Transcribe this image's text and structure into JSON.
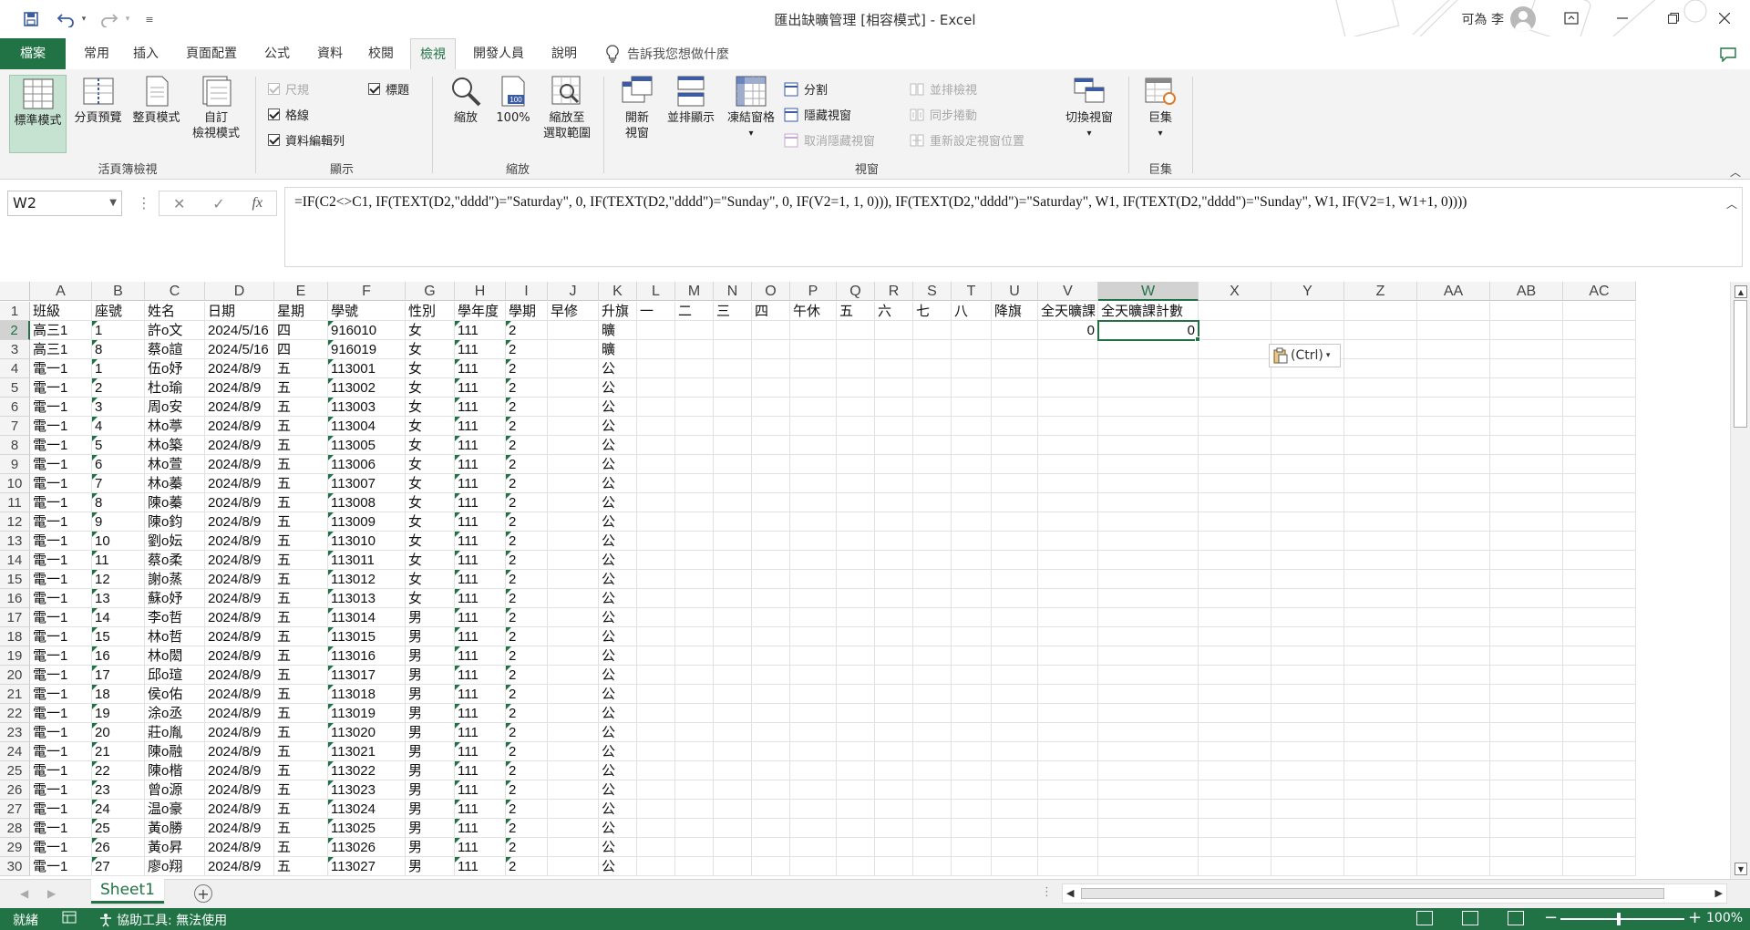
{
  "titlebar": {
    "doc_title": "匯出缺曠管理 [相容模式] - Excel",
    "user_name": "可為 李",
    "icons": [
      "save-icon",
      "undo-icon",
      "redo-icon",
      "customize-qa-icon",
      "ribbon-display-icon",
      "minimize-icon",
      "restore-icon",
      "close-icon"
    ]
  },
  "tabs": {
    "file": "檔案",
    "items": [
      "常用",
      "插入",
      "頁面配置",
      "公式",
      "資料",
      "校閱",
      "檢視",
      "開發人員",
      "說明"
    ],
    "active": "檢視",
    "tell_me": "告訴我您想做什麼"
  },
  "ribbon": {
    "workbook_views": {
      "label": "活頁簿檢視",
      "normal": "標準模式",
      "page_break": "分頁預覽",
      "page_layout": "整頁模式",
      "custom_1": "自訂",
      "custom_2": "檢視模式"
    },
    "show": {
      "label": "顯示",
      "ruler": "尺規",
      "gridlines": "格線",
      "formula_bar": "資料編輯列",
      "headings": "標題"
    },
    "zoom": {
      "label": "縮放",
      "zoom": "縮放",
      "hundred": "100%",
      "to_selection_1": "縮放至",
      "to_selection_2": "選取範圍"
    },
    "window": {
      "label": "視窗",
      "new_window_1": "開新",
      "new_window_2": "視窗",
      "arrange_all": "並排顯示",
      "freeze_panes": "凍結窗格",
      "split": "分割",
      "hide": "隱藏視窗",
      "unhide": "取消隱藏視窗",
      "view_side_by_side": "並排檢視",
      "sync_scroll": "同步捲動",
      "reset_position": "重新設定視窗位置",
      "switch_windows": "切換視窗"
    },
    "macros": {
      "label": "巨集",
      "macros": "巨集"
    }
  },
  "formula_bar": {
    "name_box": "W2",
    "formula": "=IF(C2<>C1, IF(TEXT(D2,\"dddd\")=\"Saturday\", 0, IF(TEXT(D2,\"dddd\")=\"Sunday\", 0, IF(V2=1, 1, 0))), IF(TEXT(D2,\"dddd\")=\"Saturday\", W1, IF(TEXT(D2,\"dddd\")=\"Sunday\", W1, IF(V2=1, W1+1, 0))))"
  },
  "grid": {
    "columns": [
      "A",
      "B",
      "C",
      "D",
      "E",
      "F",
      "G",
      "H",
      "I",
      "J",
      "K",
      "L",
      "M",
      "N",
      "O",
      "P",
      "Q",
      "R",
      "S",
      "T",
      "U",
      "V",
      "W",
      "X",
      "Y",
      "Z",
      "AA",
      "AB",
      "AC"
    ],
    "selected_column": "W",
    "selected_row": 2,
    "header_row": [
      "班級",
      "座號",
      "姓名",
      "日期",
      "星期",
      "學號",
      "性別",
      "學年度",
      "學期",
      "早修",
      "升旗",
      "一",
      "二",
      "三",
      "四",
      "午休",
      "五",
      "六",
      "七",
      "八",
      "降旗",
      "全天曠課",
      "全天曠課計數"
    ],
    "rows": [
      [
        "高三1",
        "1",
        "許o文",
        "2024/5/16",
        "四",
        "916010",
        "女",
        "111",
        "2",
        "",
        "曠",
        "",
        "",
        "",
        "",
        "",
        "",
        "",
        "",
        "",
        "",
        "0",
        "0"
      ],
      [
        "高三1",
        "8",
        "蔡o諠",
        "2024/5/16",
        "四",
        "916019",
        "女",
        "111",
        "2",
        "",
        "曠",
        "",
        "",
        "",
        "",
        "",
        "",
        "",
        "",
        "",
        "",
        "",
        ""
      ],
      [
        "電一1",
        "1",
        "伍o妤",
        "2024/8/9",
        "五",
        "113001",
        "女",
        "111",
        "2",
        "",
        "公",
        "",
        "",
        "",
        "",
        "",
        "",
        "",
        "",
        "",
        "",
        "",
        ""
      ],
      [
        "電一1",
        "2",
        "杜o瑜",
        "2024/8/9",
        "五",
        "113002",
        "女",
        "111",
        "2",
        "",
        "公",
        "",
        "",
        "",
        "",
        "",
        "",
        "",
        "",
        "",
        "",
        "",
        ""
      ],
      [
        "電一1",
        "3",
        "周o安",
        "2024/8/9",
        "五",
        "113003",
        "女",
        "111",
        "2",
        "",
        "公",
        "",
        "",
        "",
        "",
        "",
        "",
        "",
        "",
        "",
        "",
        "",
        ""
      ],
      [
        "電一1",
        "4",
        "林o葶",
        "2024/8/9",
        "五",
        "113004",
        "女",
        "111",
        "2",
        "",
        "公",
        "",
        "",
        "",
        "",
        "",
        "",
        "",
        "",
        "",
        "",
        "",
        ""
      ],
      [
        "電一1",
        "5",
        "林o築",
        "2024/8/9",
        "五",
        "113005",
        "女",
        "111",
        "2",
        "",
        "公",
        "",
        "",
        "",
        "",
        "",
        "",
        "",
        "",
        "",
        "",
        "",
        ""
      ],
      [
        "電一1",
        "6",
        "林o萱",
        "2024/8/9",
        "五",
        "113006",
        "女",
        "111",
        "2",
        "",
        "公",
        "",
        "",
        "",
        "",
        "",
        "",
        "",
        "",
        "",
        "",
        "",
        ""
      ],
      [
        "電一1",
        "7",
        "林o蓁",
        "2024/8/9",
        "五",
        "113007",
        "女",
        "111",
        "2",
        "",
        "公",
        "",
        "",
        "",
        "",
        "",
        "",
        "",
        "",
        "",
        "",
        "",
        ""
      ],
      [
        "電一1",
        "8",
        "陳o蓁",
        "2024/8/9",
        "五",
        "113008",
        "女",
        "111",
        "2",
        "",
        "公",
        "",
        "",
        "",
        "",
        "",
        "",
        "",
        "",
        "",
        "",
        "",
        ""
      ],
      [
        "電一1",
        "9",
        "陳o鈞",
        "2024/8/9",
        "五",
        "113009",
        "女",
        "111",
        "2",
        "",
        "公",
        "",
        "",
        "",
        "",
        "",
        "",
        "",
        "",
        "",
        "",
        "",
        ""
      ],
      [
        "電一1",
        "10",
        "劉o妘",
        "2024/8/9",
        "五",
        "113010",
        "女",
        "111",
        "2",
        "",
        "公",
        "",
        "",
        "",
        "",
        "",
        "",
        "",
        "",
        "",
        "",
        "",
        ""
      ],
      [
        "電一1",
        "11",
        "蔡o柔",
        "2024/8/9",
        "五",
        "113011",
        "女",
        "111",
        "2",
        "",
        "公",
        "",
        "",
        "",
        "",
        "",
        "",
        "",
        "",
        "",
        "",
        "",
        ""
      ],
      [
        "電一1",
        "12",
        "謝o蒸",
        "2024/8/9",
        "五",
        "113012",
        "女",
        "111",
        "2",
        "",
        "公",
        "",
        "",
        "",
        "",
        "",
        "",
        "",
        "",
        "",
        "",
        "",
        ""
      ],
      [
        "電一1",
        "13",
        "蘇o妤",
        "2024/8/9",
        "五",
        "113013",
        "女",
        "111",
        "2",
        "",
        "公",
        "",
        "",
        "",
        "",
        "",
        "",
        "",
        "",
        "",
        "",
        "",
        ""
      ],
      [
        "電一1",
        "14",
        "李o哲",
        "2024/8/9",
        "五",
        "113014",
        "男",
        "111",
        "2",
        "",
        "公",
        "",
        "",
        "",
        "",
        "",
        "",
        "",
        "",
        "",
        "",
        "",
        ""
      ],
      [
        "電一1",
        "15",
        "林o哲",
        "2024/8/9",
        "五",
        "113015",
        "男",
        "111",
        "2",
        "",
        "公",
        "",
        "",
        "",
        "",
        "",
        "",
        "",
        "",
        "",
        "",
        "",
        ""
      ],
      [
        "電一1",
        "16",
        "林o閎",
        "2024/8/9",
        "五",
        "113016",
        "男",
        "111",
        "2",
        "",
        "公",
        "",
        "",
        "",
        "",
        "",
        "",
        "",
        "",
        "",
        "",
        "",
        ""
      ],
      [
        "電一1",
        "17",
        "邱o瑄",
        "2024/8/9",
        "五",
        "113017",
        "男",
        "111",
        "2",
        "",
        "公",
        "",
        "",
        "",
        "",
        "",
        "",
        "",
        "",
        "",
        "",
        "",
        ""
      ],
      [
        "電一1",
        "18",
        "侯o佑",
        "2024/8/9",
        "五",
        "113018",
        "男",
        "111",
        "2",
        "",
        "公",
        "",
        "",
        "",
        "",
        "",
        "",
        "",
        "",
        "",
        "",
        "",
        ""
      ],
      [
        "電一1",
        "19",
        "涂o丞",
        "2024/8/9",
        "五",
        "113019",
        "男",
        "111",
        "2",
        "",
        "公",
        "",
        "",
        "",
        "",
        "",
        "",
        "",
        "",
        "",
        "",
        "",
        ""
      ],
      [
        "電一1",
        "20",
        "莊o胤",
        "2024/8/9",
        "五",
        "113020",
        "男",
        "111",
        "2",
        "",
        "公",
        "",
        "",
        "",
        "",
        "",
        "",
        "",
        "",
        "",
        "",
        "",
        ""
      ],
      [
        "電一1",
        "21",
        "陳o融",
        "2024/8/9",
        "五",
        "113021",
        "男",
        "111",
        "2",
        "",
        "公",
        "",
        "",
        "",
        "",
        "",
        "",
        "",
        "",
        "",
        "",
        "",
        ""
      ],
      [
        "電一1",
        "22",
        "陳o楷",
        "2024/8/9",
        "五",
        "113022",
        "男",
        "111",
        "2",
        "",
        "公",
        "",
        "",
        "",
        "",
        "",
        "",
        "",
        "",
        "",
        "",
        "",
        ""
      ],
      [
        "電一1",
        "23",
        "曾o源",
        "2024/8/9",
        "五",
        "113023",
        "男",
        "111",
        "2",
        "",
        "公",
        "",
        "",
        "",
        "",
        "",
        "",
        "",
        "",
        "",
        "",
        "",
        ""
      ],
      [
        "電一1",
        "24",
        "温o豪",
        "2024/8/9",
        "五",
        "113024",
        "男",
        "111",
        "2",
        "",
        "公",
        "",
        "",
        "",
        "",
        "",
        "",
        "",
        "",
        "",
        "",
        "",
        ""
      ],
      [
        "電一1",
        "25",
        "黃o勝",
        "2024/8/9",
        "五",
        "113025",
        "男",
        "111",
        "2",
        "",
        "公",
        "",
        "",
        "",
        "",
        "",
        "",
        "",
        "",
        "",
        "",
        "",
        ""
      ],
      [
        "電一1",
        "26",
        "黃o昇",
        "2024/8/9",
        "五",
        "113026",
        "男",
        "111",
        "2",
        "",
        "公",
        "",
        "",
        "",
        "",
        "",
        "",
        "",
        "",
        "",
        "",
        "",
        ""
      ],
      [
        "電一1",
        "27",
        "廖o翔",
        "2024/8/9",
        "五",
        "113027",
        "男",
        "111",
        "2",
        "",
        "公",
        "",
        "",
        "",
        "",
        "",
        "",
        "",
        "",
        "",
        "",
        "",
        ""
      ]
    ],
    "paste_options": "(Ctrl)"
  },
  "sheets": {
    "tabs": [
      "Sheet1"
    ],
    "active": "Sheet1"
  },
  "status": {
    "ready": "就緒",
    "accessibility": "協助工具: 無法使用",
    "zoom": "100%"
  },
  "colors": {
    "accent": "#217346",
    "ribbon_bg": "#f3f3f3",
    "error_indicator": "#1e7145"
  }
}
